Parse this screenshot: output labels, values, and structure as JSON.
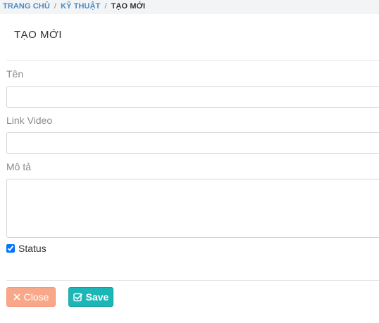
{
  "breadcrumb": {
    "home": "TRANG CHỦ",
    "section": "KỸ THUẬT",
    "current": "TẠO MỚI",
    "separator": "/"
  },
  "panel": {
    "title": "TẠO MỚI"
  },
  "form": {
    "name_label": "Tên",
    "name_value": "",
    "link_label": "Link Video",
    "link_value": "",
    "desc_label": "Mô tả",
    "desc_value": "",
    "status_label": "Status",
    "status_checked": true
  },
  "actions": {
    "close_label": "Close",
    "save_label": "Save"
  },
  "colors": {
    "link": "#4a8bc2",
    "close_button": "#f8a889",
    "save_button": "#1bb6b6"
  },
  "icons": {
    "close": "times-icon",
    "save": "check-square-icon"
  }
}
